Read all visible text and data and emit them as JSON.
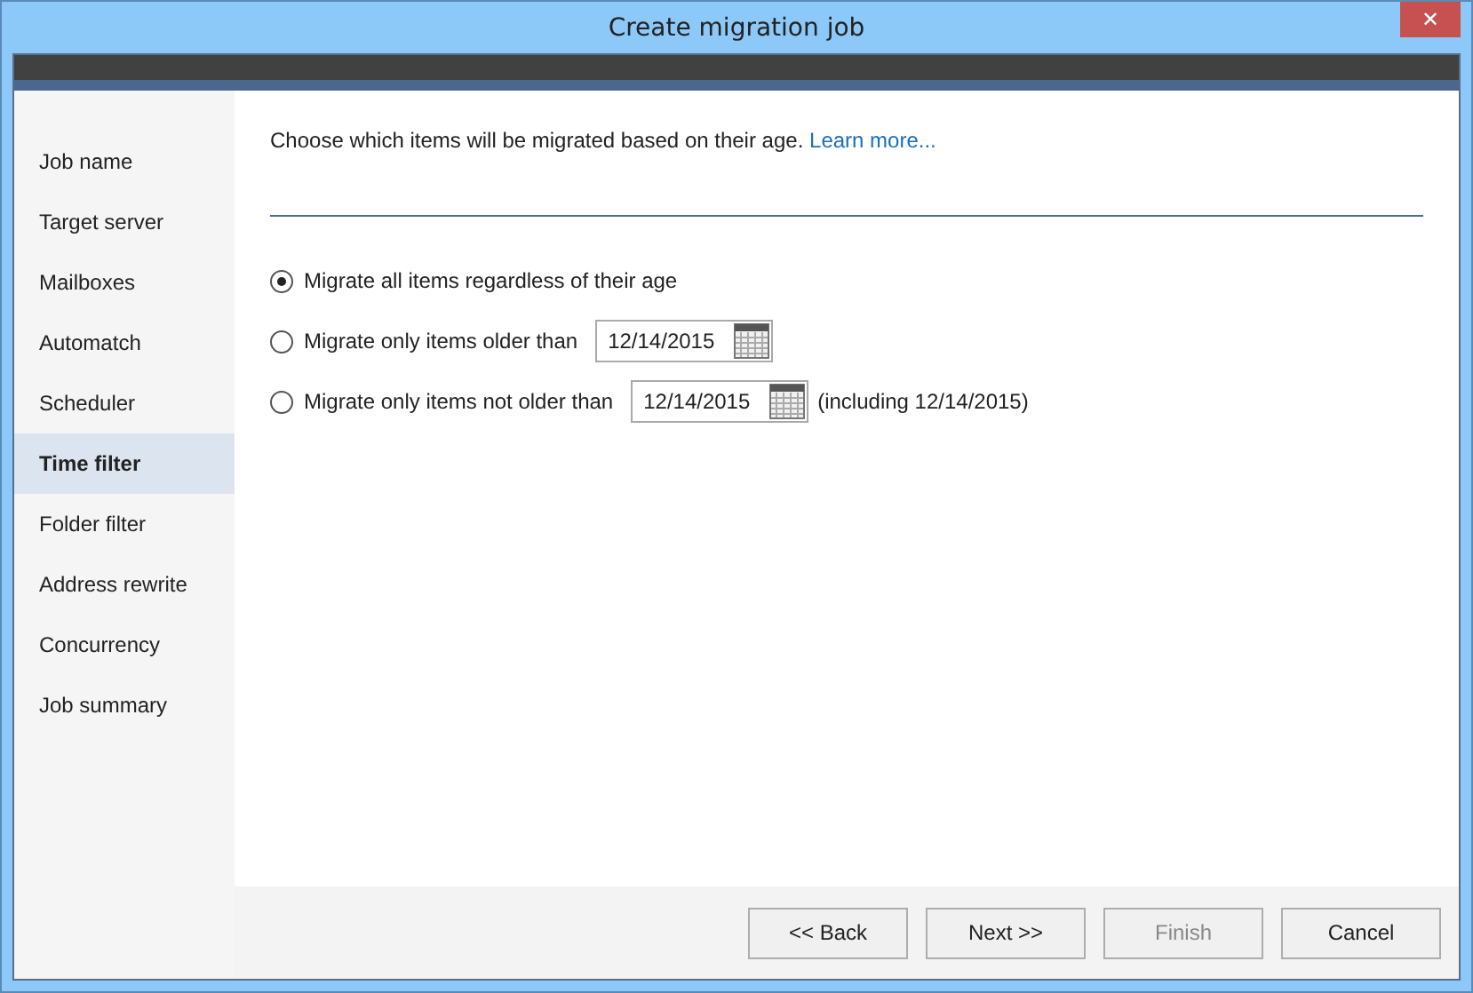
{
  "window": {
    "title": "Create migration job",
    "close": "✕"
  },
  "sidebar": {
    "items": [
      {
        "label": "Job name",
        "selected": false
      },
      {
        "label": "Target server",
        "selected": false
      },
      {
        "label": "Mailboxes",
        "selected": false
      },
      {
        "label": "Automatch",
        "selected": false
      },
      {
        "label": "Scheduler",
        "selected": false
      },
      {
        "label": "Time filter",
        "selected": true
      },
      {
        "label": "Folder filter",
        "selected": false
      },
      {
        "label": "Address rewrite",
        "selected": false
      },
      {
        "label": "Concurrency",
        "selected": false
      },
      {
        "label": "Job summary",
        "selected": false
      }
    ]
  },
  "intro": {
    "text": "Choose which items will be migrated based on their age.",
    "link": "Learn more..."
  },
  "options": [
    {
      "kind": "plain",
      "label": "Migrate all items regardless of their age",
      "selected": true
    },
    {
      "kind": "date",
      "label": "Migrate only items older than",
      "value": "12/14/2015",
      "selected": false
    },
    {
      "kind": "date",
      "label": "Migrate only items not older than",
      "value": "12/14/2015",
      "note": "(including 12/14/2015)",
      "selected": false
    }
  ],
  "buttons": [
    {
      "label": "<< Back",
      "disabled": false
    },
    {
      "label": "Next >>",
      "disabled": false
    },
    {
      "label": "Finish",
      "disabled": true
    },
    {
      "label": "Cancel",
      "disabled": false
    }
  ]
}
